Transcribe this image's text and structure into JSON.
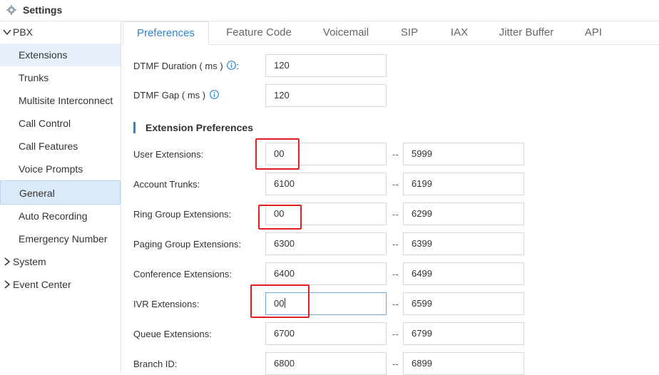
{
  "header": {
    "title": "Settings",
    "icon": "gear-icon"
  },
  "sidebar": {
    "pbx_label": "PBX",
    "items": [
      {
        "label": "Extensions"
      },
      {
        "label": "Trunks"
      },
      {
        "label": "Multisite Interconnect"
      },
      {
        "label": "Call Control"
      },
      {
        "label": "Call Features"
      },
      {
        "label": "Voice Prompts"
      },
      {
        "label": "General"
      },
      {
        "label": "Auto Recording"
      },
      {
        "label": "Emergency Number"
      }
    ],
    "system_label": "System",
    "event_center_label": "Event Center"
  },
  "tabs": [
    {
      "label": "Preferences"
    },
    {
      "label": "Feature Code"
    },
    {
      "label": "Voicemail"
    },
    {
      "label": "SIP"
    },
    {
      "label": "IAX"
    },
    {
      "label": "Jitter Buffer"
    },
    {
      "label": "API"
    }
  ],
  "dtmf": {
    "duration_label": "DTMF Duration ( ms )",
    "duration_value": "120",
    "gap_label": "DTMF Gap ( ms )",
    "gap_value": "120",
    "label_colon": ":"
  },
  "extension_preferences": {
    "title": "Extension Preferences",
    "separator": "--",
    "rows": [
      {
        "label": "User Extensions:",
        "start": "00",
        "end": "5999"
      },
      {
        "label": "Account Trunks:",
        "start": "6100",
        "end": "6199"
      },
      {
        "label": "Ring Group Extensions:",
        "start": "00",
        "end": "6299"
      },
      {
        "label": "Paging Group Extensions:",
        "start": "6300",
        "end": "6399"
      },
      {
        "label": "Conference Extensions:",
        "start": "6400",
        "end": "6499"
      },
      {
        "label": "IVR Extensions:",
        "start": "00",
        "end": "6599"
      },
      {
        "label": "Queue Extensions:",
        "start": "6700",
        "end": "6799"
      },
      {
        "label": "Branch ID:",
        "start": "6800",
        "end": "6899"
      }
    ]
  },
  "colors": {
    "accent": "#2b86d2",
    "highlight": "#e02020",
    "active_bg": "#e8f1fb"
  }
}
